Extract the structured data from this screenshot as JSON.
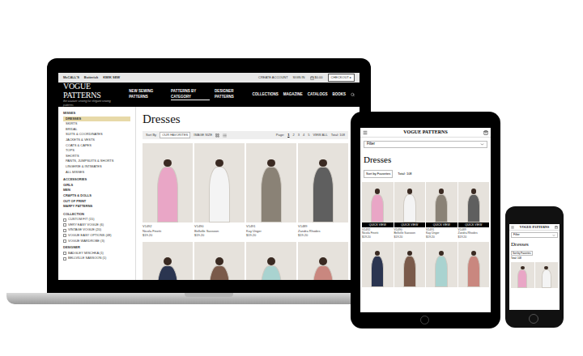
{
  "laptop": {
    "top_bar": {
      "brands": [
        "McCALL'S",
        "Butterick",
        "KWIK SEW"
      ],
      "links": [
        "CREATE ACCOUNT",
        "SIGN IN"
      ],
      "cart": "$0.00",
      "checkout": "CHECKOUT ▸"
    },
    "logo": "VOGUE PATTERNS",
    "tagline": "the couture sewing for elegant sewing patterns",
    "nav": [
      {
        "label": "NEW SEWING PATTERNS",
        "selected": false
      },
      {
        "label": "PATTERNS BY CATEGORY",
        "selected": true
      },
      {
        "label": "DESIGNER PATTERNS",
        "selected": false
      },
      {
        "label": "COLLECTIONS",
        "selected": false
      },
      {
        "label": "MAGAZINE",
        "selected": false
      },
      {
        "label": "CATALOGS",
        "selected": false
      },
      {
        "label": "BOOKS",
        "selected": false
      }
    ],
    "sidebar": {
      "heading": "MISSES",
      "items": [
        {
          "label": "DRESSES",
          "selected": true
        },
        {
          "label": "SKIRTS",
          "selected": false
        },
        {
          "label": "BRIDAL",
          "selected": false
        },
        {
          "label": "SUITS & COORDINATES",
          "selected": false
        },
        {
          "label": "JACKETS & VESTS",
          "selected": false
        },
        {
          "label": "COATS & CAPES",
          "selected": false
        },
        {
          "label": "TOPS",
          "selected": false
        },
        {
          "label": "SHORTS",
          "selected": false
        },
        {
          "label": "PANTS, JUMPSUITS & SHORTS",
          "selected": false
        },
        {
          "label": "LINGERIE & INTIMATES",
          "selected": false
        },
        {
          "label": "ALL MISSES",
          "selected": false
        }
      ],
      "categories": [
        "ACCESSORIES",
        "GIRLS",
        "MEN",
        "CRAFTS & DOLLS",
        "OUT OF PRINT",
        "MARFY PATTERNS"
      ],
      "collection": {
        "heading": "COLLECTION",
        "items": [
          {
            "label": "CUSTOM FIT (15)",
            "checked": false
          },
          {
            "label": "VERY EASY VOGUE (6)",
            "checked": false
          },
          {
            "label": "VINTAGE VOGUE (20)",
            "checked": false
          },
          {
            "label": "VOGUE EASY OPTIONS (48)",
            "checked": false
          },
          {
            "label": "VOGUE WARDROBE (3)",
            "checked": false
          }
        ]
      },
      "designer": {
        "heading": "DESIGNER",
        "items": [
          {
            "label": "BADGLEY MISCHKA (1)",
            "checked": false
          },
          {
            "label": "BELLVILLE SASSOON (1)",
            "checked": false
          }
        ]
      }
    },
    "title": "Dresses",
    "toolbar": {
      "sort_label": "Sort By",
      "sort_value": "OUR FAVORITES",
      "image_size": "IMAGE SIZE",
      "page_label": "Page:",
      "pages": [
        {
          "label": "1",
          "selected": true
        },
        {
          "label": "2",
          "selected": false
        },
        {
          "label": "3",
          "selected": false
        },
        {
          "label": "4",
          "selected": false
        },
        {
          "label": "5",
          "selected": false
        }
      ],
      "view_all": "VIEW ALL",
      "total": "Total: 108"
    },
    "products": [
      {
        "code": "V1492",
        "name": "Nicola Finetti",
        "price": "$19.20",
        "color": "#e9a6c6"
      },
      {
        "code": "V1490",
        "name": "Bellville Sassoon",
        "price": "$19.20",
        "color": "#f4f4f4"
      },
      {
        "code": "V1491",
        "name": "Kay Unger",
        "price": "$19.20",
        "color": "#8a8276"
      },
      {
        "code": "V1489",
        "name": "Zandra Rhodes",
        "price": "$19.20",
        "color": "#5f5f5f"
      }
    ],
    "more_products": [
      {
        "color": "#2b3550"
      },
      {
        "color": "#7a5a4a"
      },
      {
        "color": "#a9d3d0"
      },
      {
        "color": "#c9877f"
      }
    ]
  },
  "tablet": {
    "logo": "VOGUE PATTERNS",
    "filter": "Filter",
    "title": "Dresses",
    "sort": "Sort by Favorites",
    "total": "Total: 108",
    "quick_view": "QUICK VIEW",
    "products": [
      {
        "code": "V1492",
        "name": "Nicola Finetti",
        "price": "$19.20",
        "color": "#e9a6c6"
      },
      {
        "code": "V1490",
        "name": "Bellville Sassoon",
        "price": "$19.20",
        "color": "#f4f4f4"
      },
      {
        "code": "V1491",
        "name": "Kay Unger",
        "price": "$19.20",
        "color": "#8a8276"
      },
      {
        "code": "V1489",
        "name": "Zandra Rhodes",
        "price": "$19.20",
        "color": "#5f5f5f"
      }
    ],
    "more_products": [
      {
        "color": "#2b3550"
      },
      {
        "color": "#7a5a4a"
      },
      {
        "color": "#a9d3d0"
      },
      {
        "color": "#c9877f"
      }
    ]
  },
  "phone": {
    "logo": "VOGUE PATTERNS",
    "filter": "Filter",
    "title": "Dresses",
    "sort": "Sort by Favorites",
    "total": "Total: 108",
    "products": [
      {
        "color": "#e9a6c6"
      },
      {
        "color": "#f4f4f4"
      }
    ]
  }
}
